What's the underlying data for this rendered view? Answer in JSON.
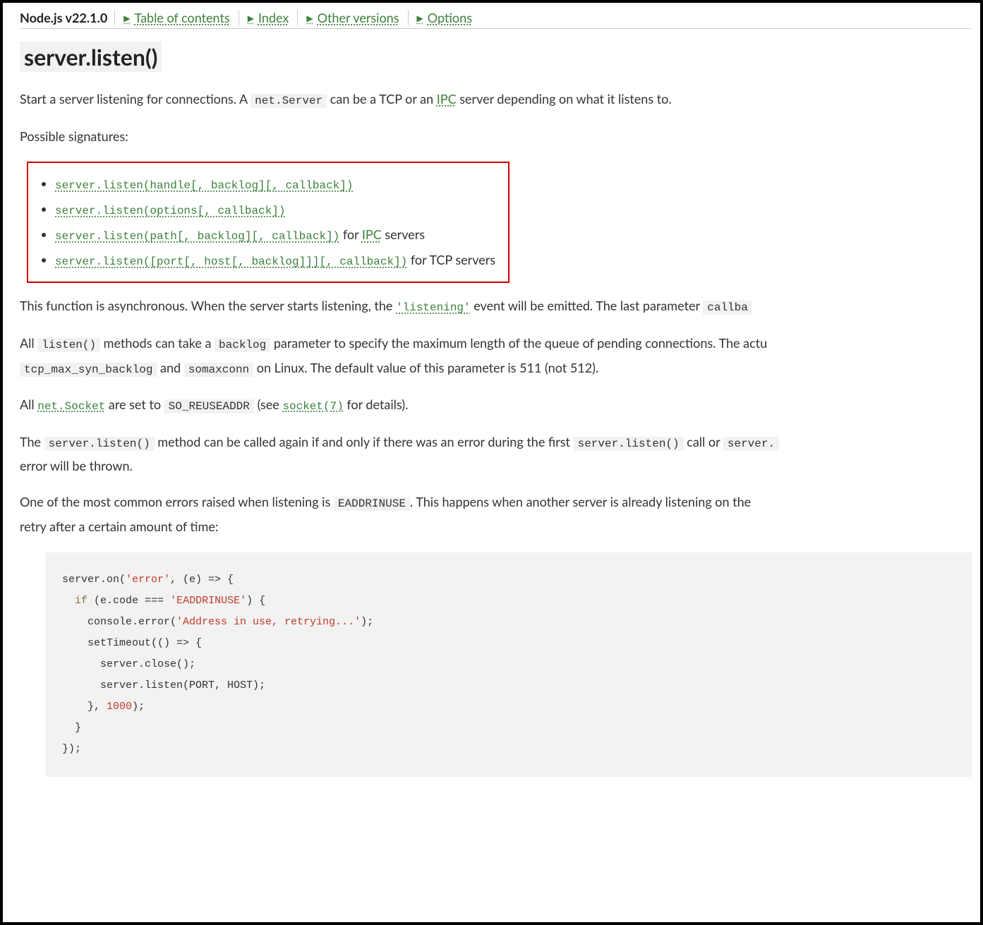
{
  "topbar": {
    "version": "Node.js v22.1.0",
    "links": [
      {
        "label": "Table of contents"
      },
      {
        "label": "Index"
      },
      {
        "label": "Other versions"
      },
      {
        "label": "Options"
      }
    ]
  },
  "heading": "server.listen()",
  "intro": {
    "pre": "Start a server listening for connections. A ",
    "code1": "net.Server",
    "mid": " can be a TCP or an ",
    "link1": "IPC",
    "post": " server depending on what it listens to."
  },
  "possible_label": "Possible signatures:",
  "signatures": [
    {
      "code": "server.listen(handle[, backlog][, callback])",
      "suffix_text": "",
      "suffix_link": ""
    },
    {
      "code": "server.listen(options[, callback])",
      "suffix_text": "",
      "suffix_link": ""
    },
    {
      "code": "server.listen(path[, backlog][, callback])",
      "suffix_text_pre": " for ",
      "suffix_link": "IPC",
      "suffix_text_post": " servers"
    },
    {
      "code": "server.listen([port[, host[, backlog]]][, callback])",
      "suffix_text_pre": " for TCP servers",
      "suffix_link": "",
      "suffix_text_post": ""
    }
  ],
  "para_async": {
    "pre": "This function is asynchronous. When the server starts listening, the ",
    "link": "'listening'",
    "mid": " event will be emitted. The last parameter ",
    "code": "callba"
  },
  "para_backlog": {
    "pre": "All ",
    "code1": "listen()",
    "mid1": " methods can take a ",
    "code2": "backlog",
    "mid2": " parameter to specify the maximum length of the queue of pending connections. The actu"
  },
  "para_backlog2": {
    "code1": "tcp_max_syn_backlog",
    "mid1": " and ",
    "code2": "somaxconn",
    "post": " on Linux. The default value of this parameter is 511 (not 512)."
  },
  "para_socket": {
    "pre": "All ",
    "link1": "net.Socket",
    "mid1": " are set to ",
    "code1": "SO_REUSEADDR",
    "mid2": " (see ",
    "link2": "socket(7)",
    "post": " for details)."
  },
  "para_again": {
    "pre": "The ",
    "code1": "server.listen()",
    "mid1": " method can be called again if and only if there was an error during the first ",
    "code2": "server.listen()",
    "mid2": " call or ",
    "code3": "server.",
    "post_line2": "error will be thrown."
  },
  "para_err": {
    "pre": "One of the most common errors raised when listening is ",
    "code1": "EADDRINUSE",
    "mid": ". This happens when another server is already listening on the ",
    "line2": "retry after a certain amount of time:"
  },
  "code_example": {
    "tokens": [
      {
        "t": "plain",
        "v": "server.on("
      },
      {
        "t": "str",
        "v": "'error'"
      },
      {
        "t": "plain",
        "v": ", (e) => {\n"
      },
      {
        "t": "plain",
        "v": "  "
      },
      {
        "t": "kw",
        "v": "if"
      },
      {
        "t": "plain",
        "v": " (e.code === "
      },
      {
        "t": "str",
        "v": "'EADDRINUSE'"
      },
      {
        "t": "plain",
        "v": ") {\n"
      },
      {
        "t": "plain",
        "v": "    console.error("
      },
      {
        "t": "str",
        "v": "'Address in use, retrying...'"
      },
      {
        "t": "plain",
        "v": ");\n"
      },
      {
        "t": "plain",
        "v": "    setTimeout(() => {\n"
      },
      {
        "t": "plain",
        "v": "      server.close();\n"
      },
      {
        "t": "plain",
        "v": "      server.listen(PORT, HOST);\n"
      },
      {
        "t": "plain",
        "v": "    }, "
      },
      {
        "t": "num",
        "v": "1000"
      },
      {
        "t": "plain",
        "v": ");\n"
      },
      {
        "t": "plain",
        "v": "  }\n"
      },
      {
        "t": "plain",
        "v": "});"
      }
    ]
  }
}
